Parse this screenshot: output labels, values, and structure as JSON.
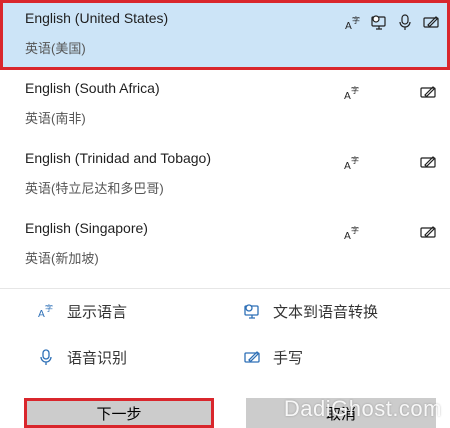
{
  "languages": [
    {
      "name": "English (United States)",
      "sub": "英语(美国)",
      "selected": true,
      "features": [
        "display-language-icon",
        "speech-to-text-monitor-icon",
        "microphone-icon",
        "handwriting-icon"
      ]
    },
    {
      "name": "English (South Africa)",
      "sub": "英语(南非)",
      "selected": false,
      "features": [
        "display-language-icon",
        "handwriting-icon"
      ]
    },
    {
      "name": "English (Trinidad and Tobago)",
      "sub": "英语(特立尼达和多巴哥)",
      "selected": false,
      "features": [
        "display-language-icon",
        "handwriting-icon"
      ]
    },
    {
      "name": "English (Singapore)",
      "sub": "英语(新加坡)",
      "selected": false,
      "features": [
        "display-language-icon",
        "handwriting-icon"
      ]
    }
  ],
  "legend": [
    {
      "icon": "display-language-icon",
      "label": "显示语言"
    },
    {
      "icon": "text-to-speech-icon",
      "label": "文本到语音转换"
    },
    {
      "icon": "microphone-icon",
      "label": "语音识别"
    },
    {
      "icon": "handwriting-icon",
      "label": "手写"
    }
  ],
  "buttons": {
    "next": "下一步",
    "cancel": "取消"
  },
  "watermark": "DadiGhost.com",
  "colors": {
    "selected_bg": "#cce4f7",
    "highlight_border": "#d9262c",
    "icon_blue": "#2d6fb6",
    "button_bg": "#cccccc"
  }
}
